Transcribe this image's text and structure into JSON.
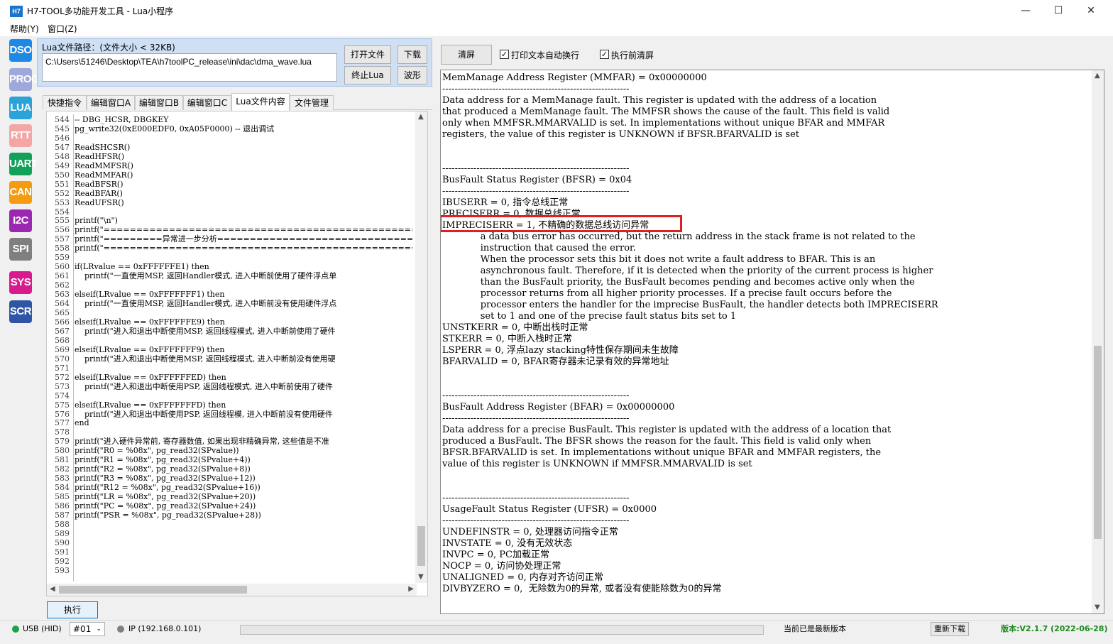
{
  "window": {
    "icon_text": "H7",
    "title": "H7-TOOL多功能开发工具 - Lua小程序",
    "minimize": "—",
    "maximize": "☐",
    "close": "✕"
  },
  "menu": [
    "帮助(Y)",
    "窗口(Z)"
  ],
  "sidebar": [
    {
      "label": "DSO",
      "color": "#1e88e5"
    },
    {
      "label": "PROG",
      "color": "#9fa8da"
    },
    {
      "label": "LUA",
      "color": "#29a3d8"
    },
    {
      "label": "RTT",
      "color": "#f4a6a6"
    },
    {
      "label": "UART",
      "color": "#12a05a"
    },
    {
      "label": "CAN",
      "color": "#f39c12"
    },
    {
      "label": "I2C",
      "color": "#9c27b0"
    },
    {
      "label": "SPI",
      "color": "#7f7f7f"
    },
    {
      "label": "SYS",
      "color": "#d81b8c"
    },
    {
      "label": "SCR",
      "color": "#2f55a4"
    }
  ],
  "left": {
    "path_label": "Lua文件路径：(文件大小 < 32KB)",
    "path_value": "C:\\Users\\51246\\Desktop\\TEA\\h7toolPC_release\\ini\\dac\\dma_wave.lua",
    "buttons": {
      "open": "打开文件",
      "download": "下载",
      "stop": "终止Lua",
      "wave": "波形"
    },
    "tabs": [
      "快捷指令",
      "编辑窗口A",
      "编辑窗口B",
      "编辑窗口C",
      "Lua文件内容",
      "文件管理"
    ],
    "active_tab": 4,
    "line_numbers": "544\n545\n546\n547\n548\n549\n550\n551\n552\n553\n554\n555\n556\n557\n558\n559\n560\n561\n562\n563\n564\n565\n566\n567\n568\n569\n570\n571\n572\n573\n574\n575\n576\n577\n578\n579\n580\n581\n582\n583\n584\n585\n586\n587\n588\n589\n590\n591\n592\n593",
    "code": "-- DBG_HCSR, DBGKEY\npg_write32(0xE000EDF0, 0xA05F0000) -- 退出调试\n\nReadSHCSR()\nReadHFSR()\nReadMMFSR()\nReadMMFAR()\nReadBFSR()\nReadBFAR()\nReadUFSR()\n\nprintf(\"\\n\")\nprintf(\"==========================================================\nprintf(\"=========异常进一步分析=========================================\nprintf(\"==========================================================\n\nif(LRvalue == 0xFFFFFFE1) then\n    printf(\"一直使用MSP, 返回Handler模式, 进入中断前使用了硬件浮点单\n\nelseif(LRvalue == 0xFFFFFFF1) then\n    printf(\"一直使用MSP, 返回Handler模式, 进入中断前没有使用硬件浮点\n\nelseif(LRvalue == 0xFFFFFFE9) then\n    printf(\"进入和退出中断使用MSP, 返回线程模式, 进入中断前使用了硬件\n\nelseif(LRvalue == 0xFFFFFFF9) then\n    printf(\"进入和退出中断使用MSP, 返回线程模式, 进入中断前没有使用硬\n\nelseif(LRvalue == 0xFFFFFFED) then\n    printf(\"进入和退出中断使用PSP, 返回线程模式, 进入中断前使用了硬件\n\nelseif(LRvalue == 0xFFFFFFFD) then\n    printf(\"进入和退出中断使用PSP, 返回线程模, 进入中断前没有使用硬件\nend\n\nprintf(\"进入硬件异常前, 寄存器数值, 如果出现非精确异常, 这些值是不准\nprintf(\"R0 = %08x\", pg_read32(SPvalue))\nprintf(\"R1 = %08x\", pg_read32(SPvalue+4))\nprintf(\"R2 = %08x\", pg_read32(SPvalue+8))\nprintf(\"R3 = %08x\", pg_read32(SPvalue+12))\nprintf(\"R12 = %08x\", pg_read32(SPvalue+16))\nprintf(\"LR = %08x\", pg_read32(SPvalue+20))\nprintf(\"PC = %08x\", pg_read32(SPvalue+24))\nprintf(\"PSR = %08x\", pg_read32(SPvalue+28))\n\n\n\n\n",
    "exec_button": "执行"
  },
  "right": {
    "clear_button": "清屏",
    "auto_wrap_label": "打印文本自动换行",
    "auto_wrap_checked": true,
    "clear_before_label": "执行前清屏",
    "clear_before_checked": true,
    "output_text": "MemManage Address Register (MMFAR) = 0x00000000\n------------------------------------------------------------\nData address for a MemManage fault. This register is updated with the address of a location\nthat produced a MemManage fault. The MMFSR shows the cause of the fault. This field is valid\nonly when MMFSR.MMARVALID is set. In implementations without unique BFAR and MMFAR\nregisters, the value of this register is UNKNOWN if BFSR.BFARVALID is set\n\n\n------------------------------------------------------------\nBusFault Status Register (BFSR) = 0x04\n------------------------------------------------------------\nIBUSERR = 0, 指令总线正常\nPRECISERR = 0, 数据总线正常\nIMPRECISERR = 1, 不精确的数据总线访问异常\n             a data bus error has occurred, but the return address in the stack frame is not related to the\n             instruction that caused the error.\n             When the processor sets this bit it does not write a fault address to BFAR. This is an\n             asynchronous fault. Therefore, if it is detected when the priority of the current process is higher\n             than the BusFault priority, the BusFault becomes pending and becomes active only when the\n             processor returns from all higher priority processes. If a precise fault occurs before the\n             processor enters the handler for the imprecise BusFault, the handler detects both IMPRECISERR\n             set to 1 and one of the precise fault status bits set to 1\nUNSTKERR = 0, 中断出栈时正常\nSTKERR = 0, 中断入栈时正常\nLSPERR = 0, 浮点lazy stacking特性保存期间未生故障\nBFARVALID = 0, BFAR寄存器未记录有效的异常地址\n\n\n------------------------------------------------------------\nBusFault Address Register (BFAR) = 0x00000000\n------------------------------------------------------------\nData address for a precise BusFault. This register is updated with the address of a location that\nproduced a BusFault. The BFSR shows the reason for the fault. This field is valid only when\nBFSR.BFARVALID is set. In implementations without unique BFAR and MMFAR registers, the\nvalue of this register is UNKNOWN if MMFSR.MMARVALID is set\n\n\n------------------------------------------------------------\nUsageFault Status Register (UFSR) = 0x0000\n------------------------------------------------------------\nUNDEFINSTR = 0, 处理器访问指令正常\nINVSTATE = 0, 没有无效状态\nINVPC = 0, PC加载正常\nNOCP = 0, 访问协处理正常\nUNALIGNED = 0, 内存对齐访问正常\nDIVBYZERO = 0,  无除数为0的异常, 或者没有使能除数为0的异常"
  },
  "status": {
    "usb": "USB (HID)",
    "usb_color": "#1aa34a",
    "device": "#01",
    "ip": "IP (192.168.0.101)",
    "ip_color": "#808080",
    "update_msg": "当前已是最新版本",
    "redownload": "重新下载",
    "version": "版本:V2.1.7 (2022-06-28)",
    "version_color": "#1a8a1a"
  }
}
